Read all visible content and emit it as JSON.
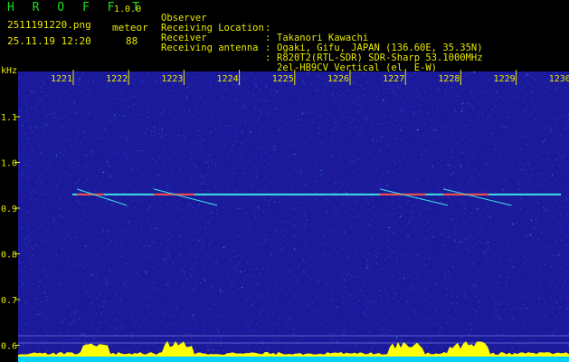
{
  "header": {
    "app_name": "H R O F F T",
    "version": "1.0.0",
    "filename": "2511191220.png",
    "timestamp": "25.11.19 12:20",
    "meteor_label": "meteor",
    "meteor_count": "88",
    "info_rows": [
      {
        "key": "Observer",
        "value": "Takanori Kawachi"
      },
      {
        "key": "Receiving Location",
        "value": "Ogaki, Gifu, JAPAN (136.60E, 35.35N)"
      },
      {
        "key": "Receiver",
        "value": "R820T2(RTL-SDR) SDR-Sharp 53.1000MHz"
      },
      {
        "key": "Receiving antenna",
        "value": "2el-HB9CV Vertical (el. E-W)"
      }
    ]
  },
  "spectrogram": {
    "unit_label": "kHz",
    "x_ticks": [
      "1221",
      "1222",
      "1223",
      "1224",
      "1225",
      "1226",
      "1227",
      "1228",
      "1229",
      "1230"
    ],
    "y_ticks": [
      "1.1",
      "1.0",
      "0.9",
      "0.8",
      "0.7",
      "0.6"
    ],
    "carrier_khz": 0.93,
    "colors": {
      "background": "#1a1a9a",
      "tick_label": "#e8e800",
      "carrier": "#40e0e0",
      "meteor": "#ff4040",
      "baseline": "#00d0ff",
      "histogram": "#ffff00"
    }
  }
}
